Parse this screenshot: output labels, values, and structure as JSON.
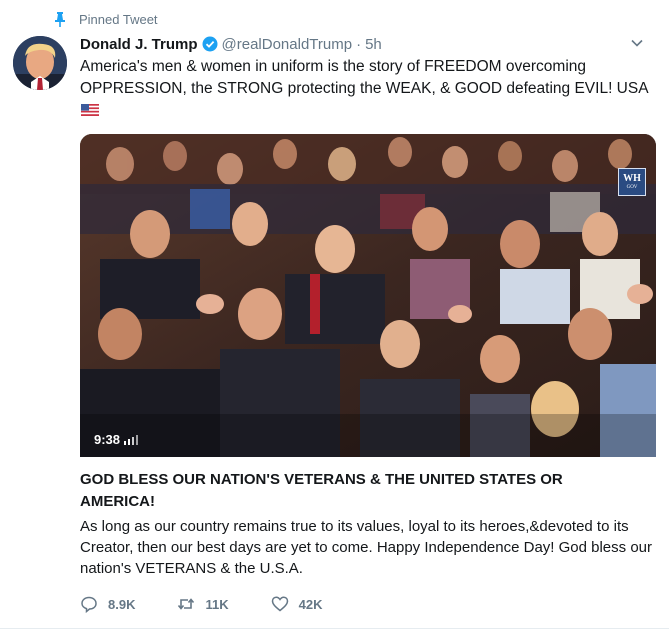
{
  "pinned": {
    "label": "Pinned Tweet"
  },
  "author": {
    "name": "Donald J. Trump",
    "handle": "@realDonaldTrump",
    "separator": "·",
    "time": "5h"
  },
  "tweet": {
    "text": "America's men & women in uniform is the story of FREEDOM overcoming OPPRESSION, the STRONG protecting the WEAK, & GOOD defeating EVIL! USA"
  },
  "media": {
    "duration": "9:38",
    "watermark_top": "WH",
    "watermark_bottom": "GOV"
  },
  "card": {
    "title": "GOD BLESS OUR NATION'S VETERANS & THE UNITED STATES OR AMERICA!",
    "description": "As long as our country remains true to its values, loyal to its heroes,&devoted to its Creator, then our best days are yet to come. Happy Independence Day! God bless our nation's VETERANS & the U.S.A."
  },
  "actions": {
    "replies": "8.9K",
    "retweets": "11K",
    "likes": "42K"
  },
  "colors": {
    "verified": "#1da1f2",
    "secondary_text": "#657786",
    "pin": "#1da1f2"
  },
  "icons": [
    "pin-icon",
    "verified-icon",
    "chevron-down-icon",
    "us-flag-icon",
    "volume-icon",
    "reply-icon",
    "retweet-icon",
    "like-icon"
  ]
}
